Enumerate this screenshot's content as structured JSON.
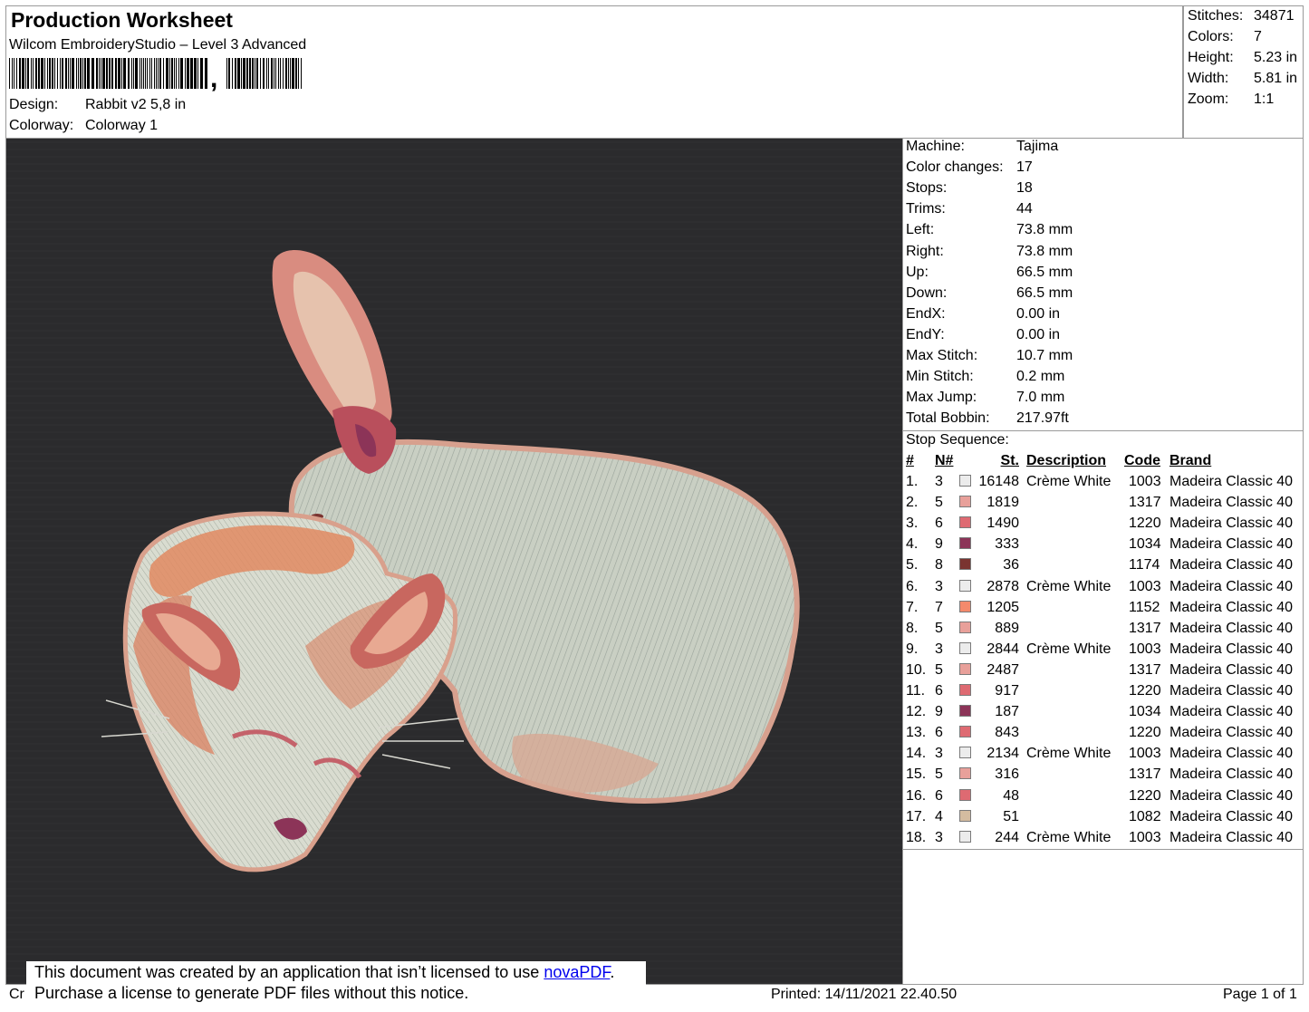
{
  "header": {
    "title": "Production Worksheet",
    "software": "Wilcom EmbroideryStudio – Level 3 Advanced",
    "barcode_comma": ",",
    "design_label": "Design:",
    "design_value": "Rabbit v2 5,8 in",
    "colorway_label": "Colorway:",
    "colorway_value": "Colorway 1"
  },
  "summary": [
    {
      "label": "Stitches:",
      "value": "34871"
    },
    {
      "label": "Colors:",
      "value": "7"
    },
    {
      "label": "Height:",
      "value": "5.23 in"
    },
    {
      "label": "Width:",
      "value": "5.81 in"
    },
    {
      "label": "Zoom:",
      "value": "1:1"
    }
  ],
  "machine_info": [
    {
      "label": "Machine:",
      "value": "Tajima"
    },
    {
      "label": "Color changes:",
      "value": "17"
    },
    {
      "label": "Stops:",
      "value": "18"
    },
    {
      "label": "Trims:",
      "value": "44"
    },
    {
      "label": "Left:",
      "value": "73.8 mm"
    },
    {
      "label": "Right:",
      "value": "73.8 mm"
    },
    {
      "label": "Up:",
      "value": "66.5 mm"
    },
    {
      "label": "Down:",
      "value": "66.5 mm"
    },
    {
      "label": "EndX:",
      "value": "0.00 in"
    },
    {
      "label": "EndY:",
      "value": "0.00 in"
    },
    {
      "label": "Max Stitch:",
      "value": "10.7 mm"
    },
    {
      "label": "Min Stitch:",
      "value": "0.2 mm"
    },
    {
      "label": "Max Jump:",
      "value": "7.0 mm"
    },
    {
      "label": "Total Bobbin:",
      "value": "217.97ft"
    }
  ],
  "stop_sequence": {
    "title": "Stop Sequence:",
    "headers": {
      "index": "#",
      "needle": "N#",
      "stitches": "St.",
      "description": "Description",
      "code": "Code",
      "brand": "Brand"
    },
    "rows": [
      {
        "index": "1.",
        "needle": "3",
        "color": "#ececec",
        "stitches": "16148",
        "description": "Crème White",
        "code": "1003",
        "brand": "Madeira Classic 40"
      },
      {
        "index": "2.",
        "needle": "5",
        "color": "#e8a09a",
        "stitches": "1819",
        "description": "",
        "code": "1317",
        "brand": "Madeira Classic 40"
      },
      {
        "index": "3.",
        "needle": "6",
        "color": "#de6a72",
        "stitches": "1490",
        "description": "",
        "code": "1220",
        "brand": "Madeira Classic 40"
      },
      {
        "index": "4.",
        "needle": "9",
        "color": "#8c3458",
        "stitches": "333",
        "description": "",
        "code": "1034",
        "brand": "Madeira Classic 40"
      },
      {
        "index": "5.",
        "needle": "8",
        "color": "#7a3430",
        "stitches": "36",
        "description": "",
        "code": "1174",
        "brand": "Madeira Classic 40"
      },
      {
        "index": "6.",
        "needle": "3",
        "color": "#ececec",
        "stitches": "2878",
        "description": "Crème White",
        "code": "1003",
        "brand": "Madeira Classic 40"
      },
      {
        "index": "7.",
        "needle": "7",
        "color": "#f48a6c",
        "stitches": "1205",
        "description": "",
        "code": "1152",
        "brand": "Madeira Classic 40"
      },
      {
        "index": "8.",
        "needle": "5",
        "color": "#e8a09a",
        "stitches": "889",
        "description": "",
        "code": "1317",
        "brand": "Madeira Classic 40"
      },
      {
        "index": "9.",
        "needle": "3",
        "color": "#ececec",
        "stitches": "2844",
        "description": "Crème White",
        "code": "1003",
        "brand": "Madeira Classic 40"
      },
      {
        "index": "10.",
        "needle": "5",
        "color": "#e8a09a",
        "stitches": "2487",
        "description": "",
        "code": "1317",
        "brand": "Madeira Classic 40"
      },
      {
        "index": "11.",
        "needle": "6",
        "color": "#de6a72",
        "stitches": "917",
        "description": "",
        "code": "1220",
        "brand": "Madeira Classic 40"
      },
      {
        "index": "12.",
        "needle": "9",
        "color": "#8c3458",
        "stitches": "187",
        "description": "",
        "code": "1034",
        "brand": "Madeira Classic 40"
      },
      {
        "index": "13.",
        "needle": "6",
        "color": "#de6a72",
        "stitches": "843",
        "description": "",
        "code": "1220",
        "brand": "Madeira Classic 40"
      },
      {
        "index": "14.",
        "needle": "3",
        "color": "#ececec",
        "stitches": "2134",
        "description": "Crème White",
        "code": "1003",
        "brand": "Madeira Classic 40"
      },
      {
        "index": "15.",
        "needle": "5",
        "color": "#e8a09a",
        "stitches": "316",
        "description": "",
        "code": "1317",
        "brand": "Madeira Classic 40"
      },
      {
        "index": "16.",
        "needle": "6",
        "color": "#de6a72",
        "stitches": "48",
        "description": "",
        "code": "1220",
        "brand": "Madeira Classic 40"
      },
      {
        "index": "17.",
        "needle": "4",
        "color": "#d4bca0",
        "stitches": "51",
        "description": "",
        "code": "1082",
        "brand": "Madeira Classic 40"
      },
      {
        "index": "18.",
        "needle": "3",
        "color": "#ececec",
        "stitches": "244",
        "description": "Crème White",
        "code": "1003",
        "brand": "Madeira Classic 40"
      }
    ]
  },
  "notice": {
    "line1_prefix": "This document was created by an application that isn’t licensed to use ",
    "link": "novaPDF",
    "line1_suffix": ".",
    "line2": "Purchase a license to generate PDF files without this notice."
  },
  "footer": {
    "left_fragment": "Cr",
    "printed": "Printed: 14/11/2021 22.40.50",
    "page": "Page 1 of 1"
  },
  "colors": {
    "fabric": "#2b2b2d",
    "creme": "#c9cfc3",
    "pink": "#d78a7c",
    "orange": "#e08a62",
    "plum": "#8c3458"
  }
}
